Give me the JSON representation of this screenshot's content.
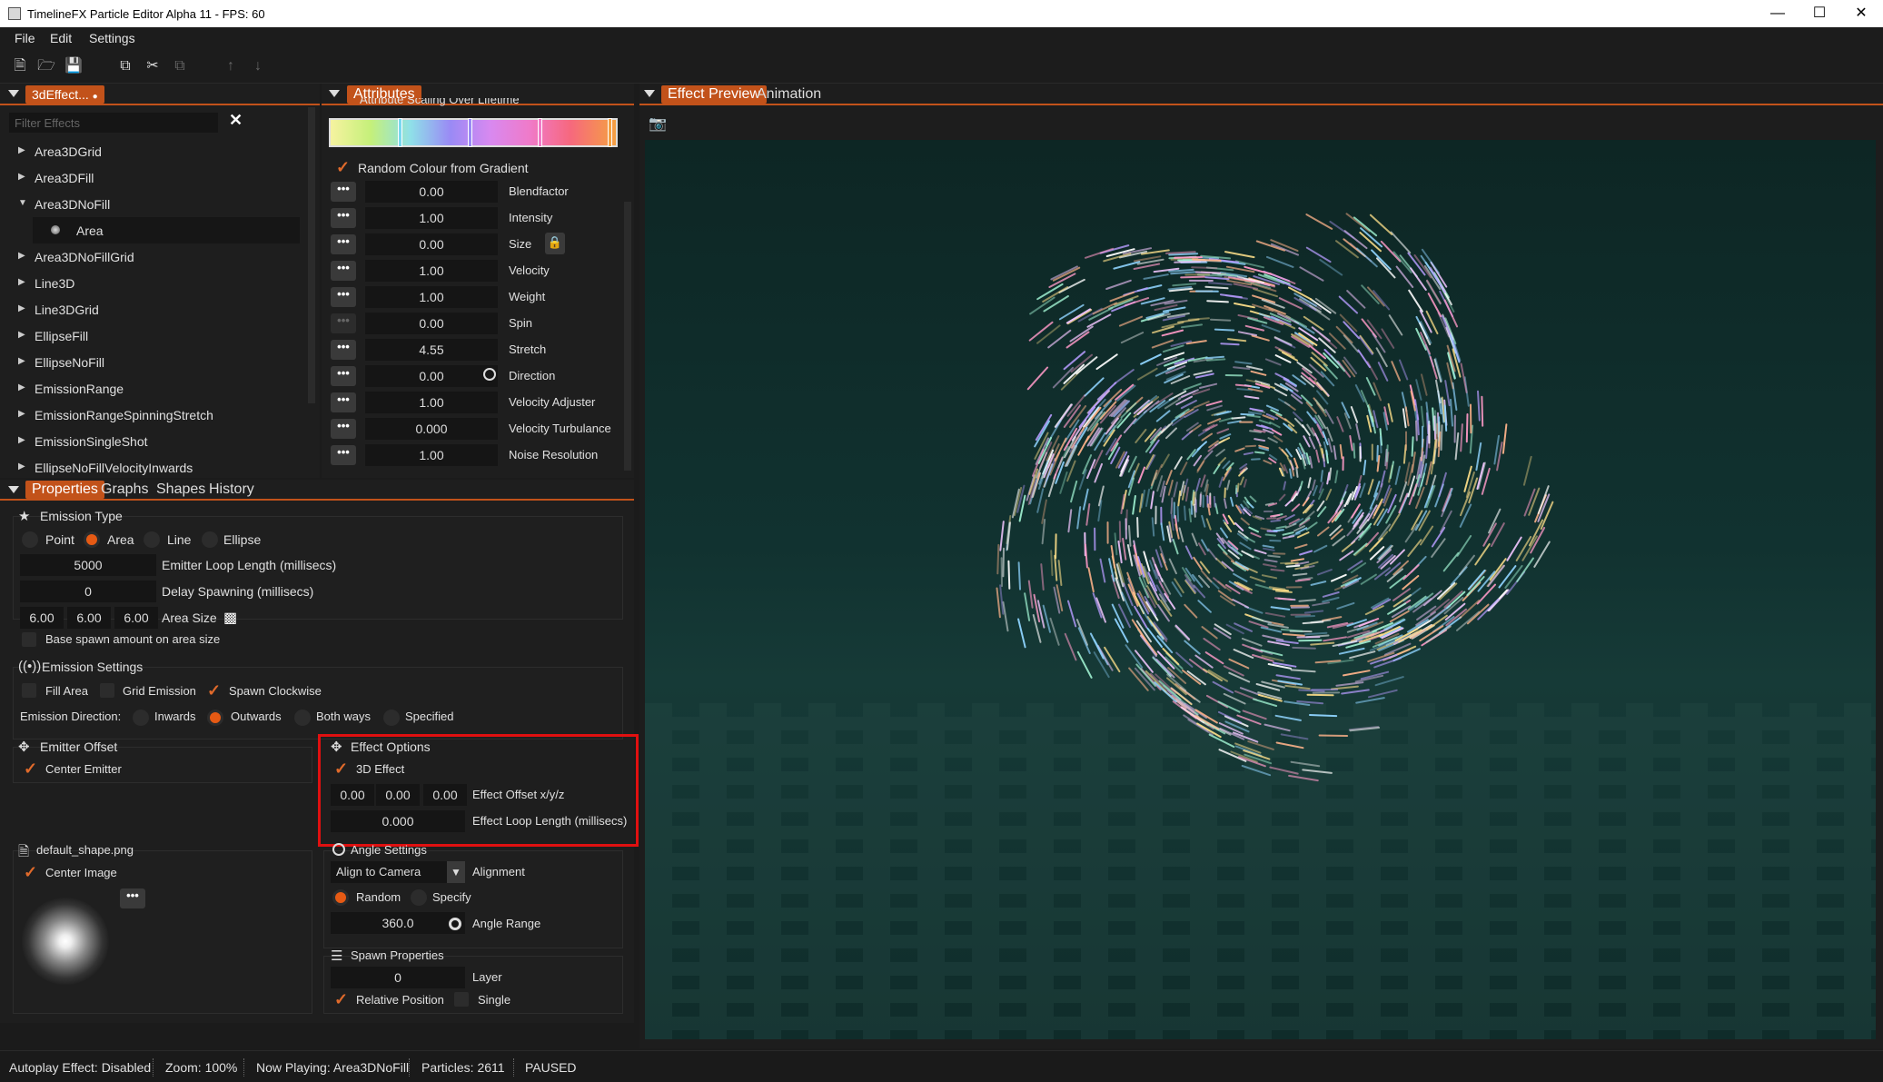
{
  "window": {
    "title": "TimelineFX Particle Editor Alpha 11 - FPS: 60",
    "min_icon": "minimize-icon",
    "max_icon": "maximize-icon",
    "close_icon": "close-icon"
  },
  "menu": {
    "file": "File",
    "edit": "Edit",
    "settings": "Settings"
  },
  "toolbar": {
    "icons": [
      "new-file-icon",
      "open-folder-icon",
      "save-icon",
      "copy-icon",
      "cut-icon",
      "paste-icon",
      "move-up-icon",
      "move-down-icon"
    ]
  },
  "effects_panel": {
    "tab": "3dEffect...",
    "filter_placeholder": "Filter Effects",
    "items": [
      {
        "label": "Area3DGrid",
        "expanded": false
      },
      {
        "label": "Area3DFill",
        "expanded": false
      },
      {
        "label": "Area3DNoFill",
        "expanded": true
      },
      {
        "label": "Area",
        "child": true
      },
      {
        "label": "Area3DNoFillGrid",
        "expanded": false
      },
      {
        "label": "Line3D",
        "expanded": false
      },
      {
        "label": "Line3DGrid",
        "expanded": false
      },
      {
        "label": "EllipseFill",
        "expanded": false
      },
      {
        "label": "EllipseNoFill",
        "expanded": false
      },
      {
        "label": "EmissionRange",
        "expanded": false
      },
      {
        "label": "EmissionRangeSpinningStretch",
        "expanded": false
      },
      {
        "label": "EmissionSingleShot",
        "expanded": false
      },
      {
        "label": "EllipseNoFillVelocityInwards",
        "expanded": false
      }
    ]
  },
  "attributes_panel": {
    "tab": "Attributes",
    "section_title": "Attribute Scaling Over Lifetime",
    "random_colour_label": "Random Colour from Gradient",
    "rows": [
      {
        "value": "0.00",
        "label": "Blendfactor"
      },
      {
        "value": "1.00",
        "label": "Intensity"
      },
      {
        "value": "0.00",
        "label": "Size"
      },
      {
        "value": "1.00",
        "label": "Velocity"
      },
      {
        "value": "1.00",
        "label": "Weight"
      },
      {
        "value": "0.00",
        "label": "Spin"
      },
      {
        "value": "4.55",
        "label": "Stretch"
      },
      {
        "value": "0.00",
        "label": "Direction"
      },
      {
        "value": "1.00",
        "label": "Velocity Adjuster"
      },
      {
        "value": "0.000",
        "label": "Velocity Turbulance"
      },
      {
        "value": "1.00",
        "label": "Noise Resolution"
      }
    ],
    "more_label": "•••"
  },
  "props_tabs": {
    "properties": "Properties",
    "graphs": "Graphs",
    "shapes": "Shapes",
    "history": "History"
  },
  "emission_type": {
    "title": "Emission Type",
    "point": "Point",
    "area": "Area",
    "line": "Line",
    "ellipse": "Ellipse",
    "loop_value": "5000",
    "loop_label": "Emitter Loop Length (millisecs)",
    "delay_value": "0",
    "delay_label": "Delay Spawning (millisecs)",
    "size_x": "6.00",
    "size_y": "6.00",
    "size_z": "6.00",
    "size_label": "Area Size",
    "base_spawn_label": "Base spawn amount on area size"
  },
  "emission_settings": {
    "title": "Emission Settings",
    "fill_area": "Fill Area",
    "grid_emission": "Grid Emission",
    "spawn_clockwise": "Spawn Clockwise",
    "direction_label": "Emission Direction:",
    "inwards": "Inwards",
    "outwards": "Outwards",
    "both_ways": "Both ways",
    "specified": "Specified"
  },
  "emitter_offset": {
    "title": "Emitter Offset",
    "center_emitter": "Center Emitter"
  },
  "effect_options": {
    "title": "Effect Options",
    "effect_3d": "3D Effect",
    "ox": "0.00",
    "oy": "0.00",
    "oz": "0.00",
    "offset_label": "Effect Offset x/y/z",
    "loop_value": "0.000",
    "loop_label": "Effect Loop Length (millisecs)"
  },
  "shape_panel": {
    "title": "default_shape.png",
    "center_image": "Center Image",
    "more": "•••"
  },
  "angle_settings": {
    "title": "Angle Settings",
    "align_value": "Align to Camera",
    "align_label": "Alignment",
    "random": "Random",
    "specify": "Specify",
    "range_value": "360.0",
    "range_label": "Angle Range"
  },
  "spawn_properties": {
    "title": "Spawn Properties",
    "layer_value": "0",
    "layer_label": "Layer",
    "relative_position": "Relative Position",
    "single": "Single"
  },
  "preview": {
    "tab_preview": "Effect Preview",
    "tab_animation": "Animation"
  },
  "status": {
    "autoplay": "Autoplay Effect: Disabled",
    "zoom": "Zoom: 100%",
    "playing": "Now Playing: Area3DNoFill",
    "particles": "Particles: 2611",
    "state": "PAUSED"
  },
  "colors": {
    "accent": "#c2521a",
    "highlight_box": "#e01010",
    "preview_bg": "#0f2a28"
  }
}
